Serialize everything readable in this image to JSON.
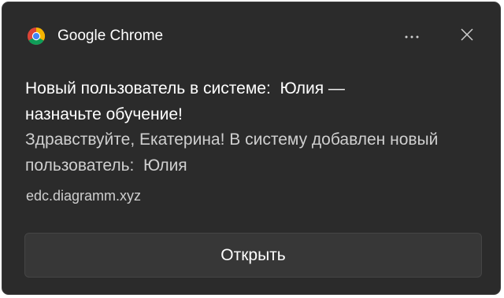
{
  "header": {
    "app_name": "Google Chrome"
  },
  "notification": {
    "title": "Новый пользователь в системе:  Юлия — назначьте обучение!",
    "message": "Здравствуйте, Екатерина! В систему добавлен новый пользователь:  Юлия",
    "source": "edc.diagramm.xyz"
  },
  "actions": {
    "open_label": "Открыть"
  },
  "icons": {
    "app": "chrome-icon",
    "more": "more-horizontal-icon",
    "close": "close-icon"
  },
  "colors": {
    "background": "#2b2b2b",
    "button": "#373737",
    "text_primary": "#ffffff",
    "text_secondary": "#cfcfcf"
  }
}
